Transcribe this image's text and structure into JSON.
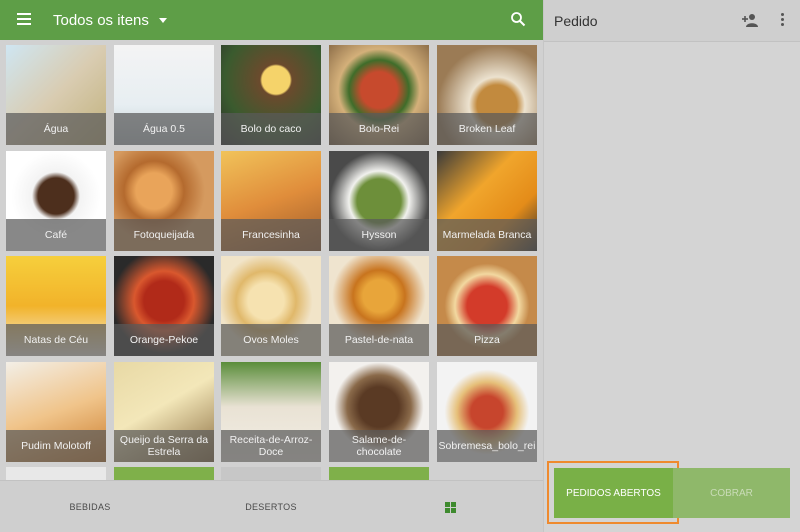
{
  "header": {
    "title": "Todos os itens"
  },
  "items": [
    {
      "label": "Água",
      "bg": "linear-gradient(135deg,#cfe6f2,#d9ccb1 50%,#c0b07a)"
    },
    {
      "label": "Água 0.5",
      "bg": "linear-gradient(180deg,#f4f4f4,#e7eef2 60%,#bfc9cf)"
    },
    {
      "label": "Bolo do caco",
      "bg": "radial-gradient(circle at 55% 35%,#f5d36a 0 14px,#6b4a2d 16px,#3a5b2e 60%,#2b2b2b)"
    },
    {
      "label": "Bolo-Rei",
      "bg": "radial-gradient(circle at 50% 45%,#c74a2d 0 18px,#3f6d2a 30px,#d4b07a 55%,#7b5d3c)"
    },
    {
      "label": "Broken Leaf",
      "bg": "radial-gradient(circle at 60% 60%,#c28a3e 0 20px,#ece2cf 28px,#9b7b55 70%)"
    },
    {
      "label": "Café",
      "bg": "radial-gradient(circle at 50% 45%,#4d2f1d 0 18px,#f3f3f3 24px,#ffffff 60%)"
    },
    {
      "label": "Fotoqueijada",
      "bg": "radial-gradient(circle at 40% 40%,#e9a45a 0 18px,#b46a2e 30px,#d59a5f 60%)"
    },
    {
      "label": "Francesinha",
      "bg": "linear-gradient(160deg,#f1c35a,#e08d3b 50%,#9b5b2a)"
    },
    {
      "label": "Hysson",
      "bg": "radial-gradient(circle at 50% 50%,#6d8f3a 0 22px,#f1f1ee 30px,#4a4a4a 70%)"
    },
    {
      "label": "Marmelada Branca",
      "bg": "linear-gradient(135deg,#3a3a3a,#f0a52c 40%,#e48c19 70%,#2f2f2f)"
    },
    {
      "label": "Natas de Céu",
      "bg": "linear-gradient(180deg,#f6cf3c,#f2b32a 50%,#f6f1e8)"
    },
    {
      "label": "Orange-Pekoe",
      "bg": "radial-gradient(circle at 50% 45%,#b12a19 0 20px,#d9582e 30px,#2a2a2a 70%)"
    },
    {
      "label": "Ovos Moles",
      "bg": "radial-gradient(circle at 45% 45%,#f6e2b0 0 18px,#e0b86a 30px,#f1e4c8 60%)"
    },
    {
      "label": "Pastel-de-nata",
      "bg": "radial-gradient(circle at 50% 40%,#e8a53a 0 16px,#c8741e 26px,#efe4cf 60%)"
    },
    {
      "label": "Pizza",
      "bg": "radial-gradient(circle at 50% 50%,#d33b2a 0 20px,#f2d8a0 32px,#c58a4a 60%)"
    },
    {
      "label": "Pudim Molotoff",
      "bg": "linear-gradient(160deg,#f3efe7,#f0c48a 50%,#c97a2a)"
    },
    {
      "label": "Queijo da Serra da Estrela",
      "bg": "linear-gradient(150deg,#e8d9a5,#f3e7b9 45%,#8a6c3f)"
    },
    {
      "label": "Receita-de-Arroz-Doce",
      "bg": "linear-gradient(180deg,#5a8d3a,#e9e2d4 45%,#f3efe6)"
    },
    {
      "label": "Salame-de-chocolate",
      "bg": "radial-gradient(circle at 50% 45%,#5a3a24 0 20px,#8a6a4a 32px,#f3f1ee 60%)"
    },
    {
      "label": "Sobremesa_bolo_rei",
      "bg": "radial-gradient(circle at 50% 50%,#c7452d 0 16px,#e6c07a 30px,#f3f3f3 60%)"
    }
  ],
  "partial_row_bg": [
    "#e8e8e8",
    "#7fb04a",
    "#c7c7c7",
    "#7fb04a"
  ],
  "bottom_nav": {
    "tab1": "BEBIDAS",
    "tab2": "DESERTOS"
  },
  "order": {
    "title": "Pedido",
    "open_orders_label": "PEDIDOS ABERTOS",
    "charge_label": "COBRAR"
  }
}
